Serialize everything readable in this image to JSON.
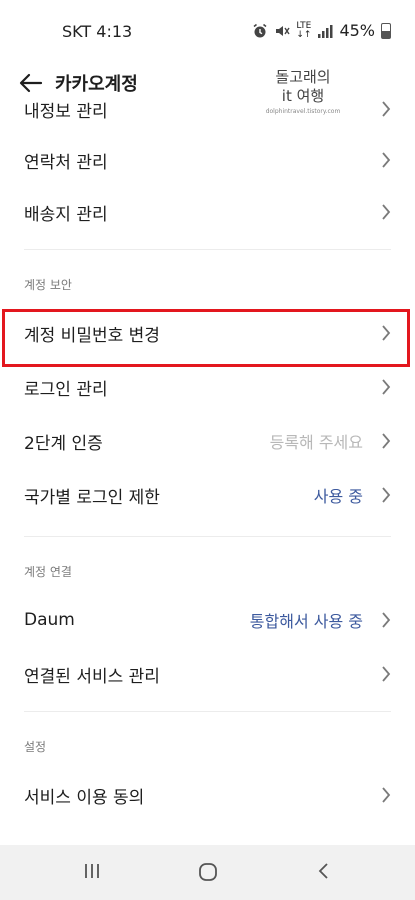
{
  "status_bar": {
    "carrier_time": "SKT 4:13",
    "network": "LTE",
    "battery": "45%",
    "icons": [
      "alarm-icon",
      "mute-icon",
      "lte-icon",
      "signal-icon",
      "battery-icon"
    ]
  },
  "header": {
    "title": "카카오계정",
    "back_icon": "arrow-left-icon"
  },
  "watermark": {
    "line1": "돌고래의",
    "line2": "it 여행",
    "line3": "dolphintravel.tistory.com"
  },
  "rows_top": [
    {
      "label": "내정보 관리"
    },
    {
      "label": "연락처 관리"
    },
    {
      "label": "배송지 관리"
    }
  ],
  "section_security": {
    "header": "계정 보안",
    "rows": [
      {
        "label": "계정 비밀번호 변경",
        "value": ""
      },
      {
        "label": "로그인 관리",
        "value": ""
      },
      {
        "label": "2단계 인증",
        "value": "등록해 주세요"
      },
      {
        "label": "국가별 로그인 제한",
        "value": "사용 중"
      }
    ]
  },
  "section_link": {
    "header": "계정 연결",
    "rows": [
      {
        "label": "Daum",
        "value": "통합해서 사용 중"
      },
      {
        "label": "연결된 서비스 관리",
        "value": ""
      }
    ]
  },
  "section_settings": {
    "header": "설정",
    "rows": [
      {
        "label": "서비스 이용 동의",
        "value": ""
      }
    ]
  },
  "colors": {
    "highlight": "#e3171e",
    "value_blue": "#3d5a9e",
    "value_gray": "#b8b8b8",
    "nav_bg": "#f1f1f1"
  },
  "navigation_bar": {
    "icons": [
      "recent-apps-icon",
      "home-icon",
      "back-icon"
    ]
  }
}
